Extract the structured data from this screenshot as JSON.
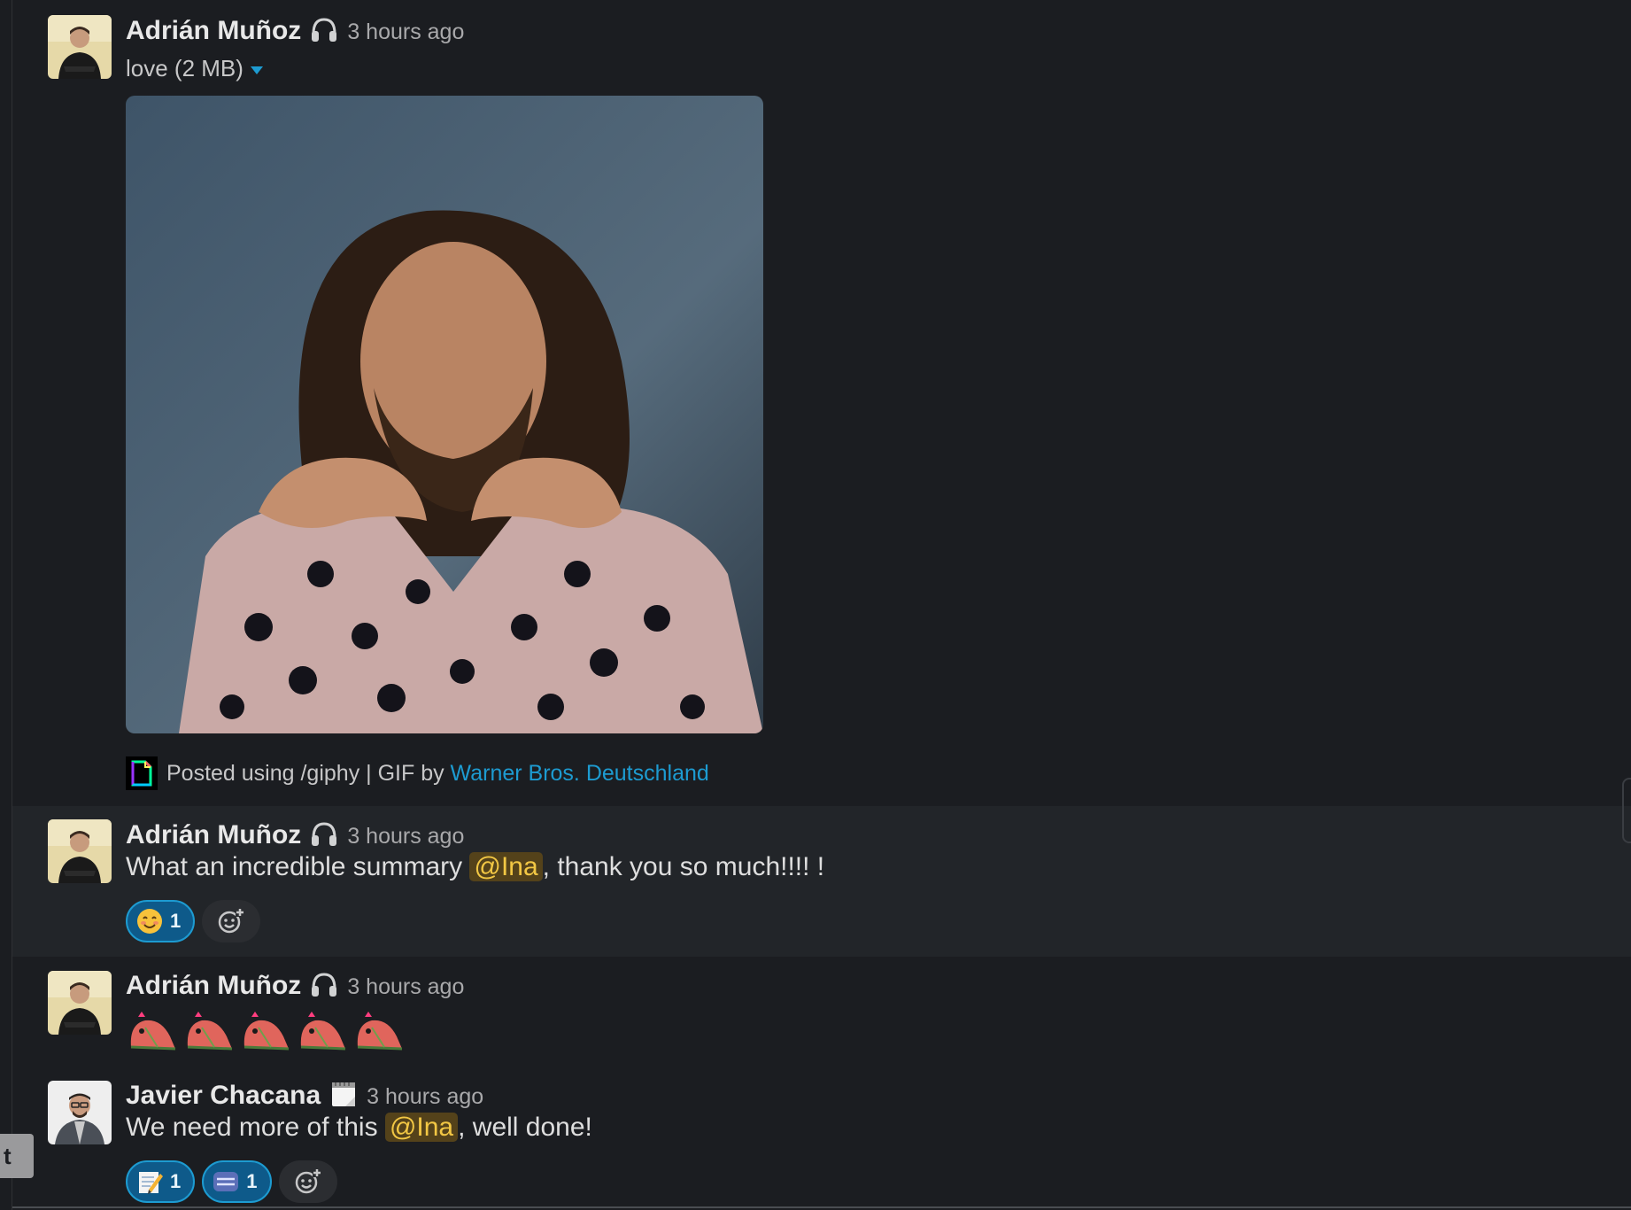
{
  "messages": [
    {
      "author": "Adrián Muñoz",
      "status_icon": "headphones-icon",
      "time": "3 hours ago",
      "file": {
        "name": "love (2 MB)"
      },
      "attribution": {
        "prefix": "Posted using /giphy | GIF by ",
        "link": "Warner Bros. Deutschland"
      }
    },
    {
      "author": "Adrián Muñoz",
      "status_icon": "headphones-icon",
      "time": "3 hours ago",
      "text_before": "What an incredible summary ",
      "mention": "@Ina",
      "text_after": ", thank you so much!!!! !",
      "reactions": [
        {
          "emoji": "blush-emoji",
          "count": "1"
        }
      ]
    },
    {
      "author": "Adrián Muñoz",
      "status_icon": "headphones-icon",
      "time": "3 hours ago",
      "emoji_count": 5,
      "emoji_name": "party-parrot-emoji"
    },
    {
      "author": "Javier Chacana",
      "status_icon": "calendar-icon",
      "time": "3 hours ago",
      "text_before": "We need more of this ",
      "mention": "@Ina",
      "text_after": ", well done!",
      "reactions": [
        {
          "emoji": "memo-emoji",
          "count": "1"
        },
        {
          "emoji": "thank-you-emoji",
          "count": "1"
        }
      ]
    }
  ],
  "side_tab": {
    "label": "t"
  },
  "colors": {
    "background": "#1b1d21",
    "hover_background": "#222529",
    "link": "#1d9bd1",
    "mention_bg": "#54421a",
    "mention_text": "#f2c744",
    "reaction_bg": "#0e5a8a"
  }
}
